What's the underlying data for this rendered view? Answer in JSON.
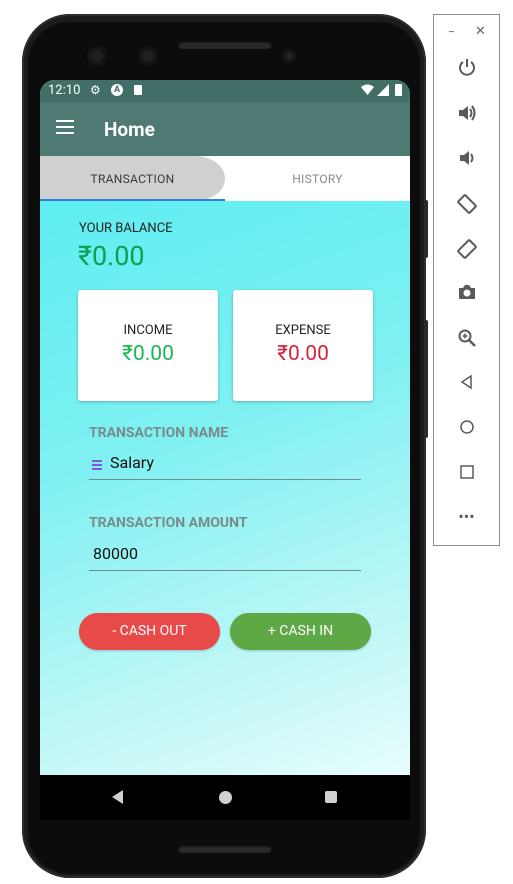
{
  "status_bar": {
    "time": "12:10"
  },
  "app_bar": {
    "title": "Home"
  },
  "tabs": [
    {
      "label": "TRANSACTION"
    },
    {
      "label": "HISTORY"
    }
  ],
  "balance": {
    "label": "YOUR BALANCE",
    "value": "₹0.00"
  },
  "income": {
    "label": "INCOME",
    "value": "₹0.00",
    "color": "#1bb553"
  },
  "expense": {
    "label": "EXPENSE",
    "value": "₹0.00",
    "color": "#d8213a"
  },
  "form": {
    "name_label": "TRANSACTION NAME",
    "name_value": "Salary",
    "amount_label": "TRANSACTION AMOUNT",
    "amount_value": "80000"
  },
  "buttons": {
    "cash_out": "- CASH OUT",
    "cash_in": "+ CASH IN"
  },
  "colors": {
    "status_bar": "#416f67",
    "app_bar": "#4f7a73",
    "accent": "#2f7fd8",
    "cash_out": "#e84a4a",
    "cash_in": "#5ea846"
  },
  "emulator_toolbar": {
    "icons": [
      "power-icon",
      "volume-up-icon",
      "volume-down-icon",
      "rotate-left-icon",
      "rotate-right-icon",
      "camera-icon",
      "zoom-icon",
      "back-icon",
      "home-icon",
      "overview-icon",
      "more-icon"
    ]
  }
}
